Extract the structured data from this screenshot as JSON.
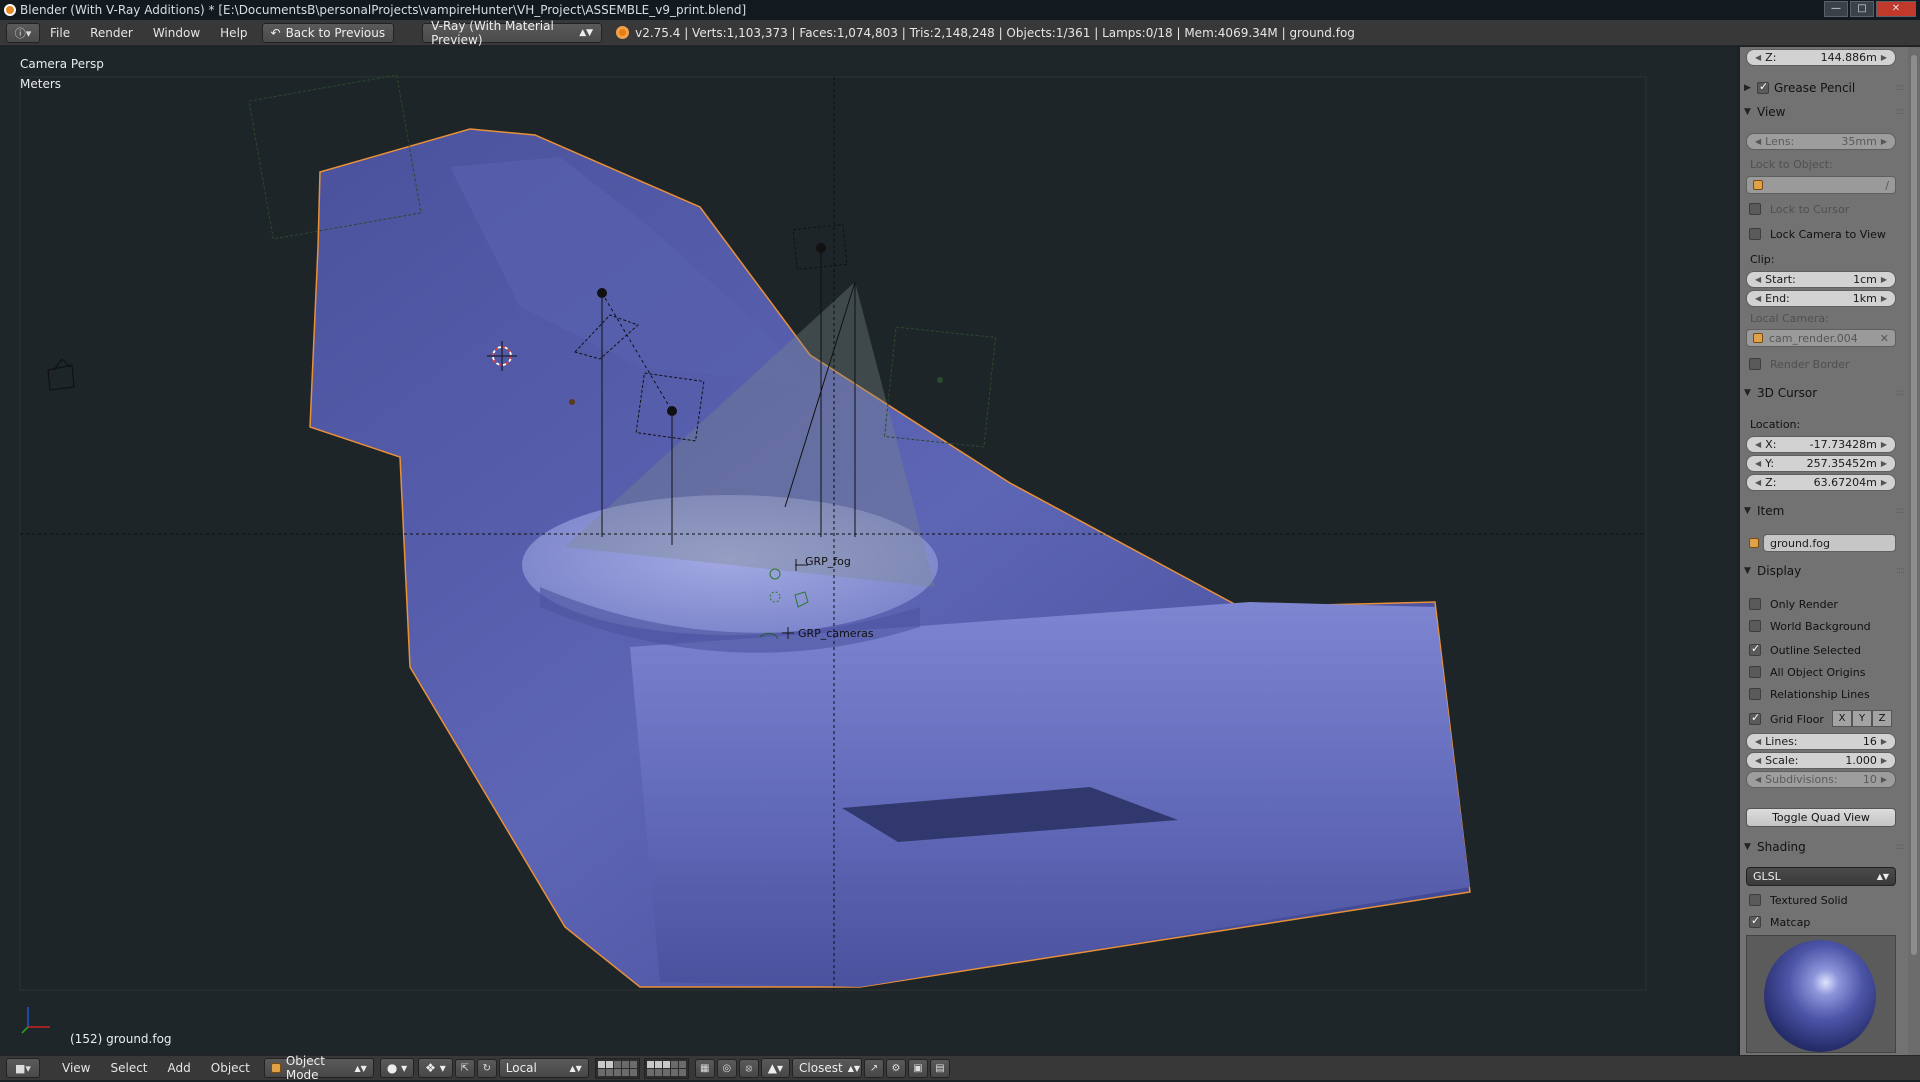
{
  "window": {
    "title": "Blender (With V-Ray Additions) * [E:\\DocumentsB\\personalProjects\\vampireHunter\\VH_Project\\ASSEMBLE_v9_print.blend]"
  },
  "info_header": {
    "menus": [
      "File",
      "Render",
      "Window",
      "Help"
    ],
    "back_button": "Back to Previous",
    "render_engine": "V-Ray (With Material Preview)",
    "stats": "v2.75.4 | Verts:1,103,373 | Faces:1,074,803 | Tris:2,148,248 | Objects:1/361 | Lamps:0/18 | Mem:4069.34M | ground.fog"
  },
  "viewport": {
    "view_name": "Camera Persp",
    "units": "Meters",
    "object_labels": [
      "GRP_fog",
      "GRP_cameras"
    ],
    "status": "(152) ground.fog"
  },
  "npanel": {
    "cursor_z_top": {
      "label": "Z:",
      "value": "144.886m"
    },
    "grease_pencil": {
      "label": "Grease Pencil",
      "checked": true
    },
    "view": {
      "title": "View",
      "lens": {
        "label": "Lens:",
        "value": "35mm"
      },
      "lock_to_object_label": "Lock to Object:",
      "lock_to_cursor": "Lock to Cursor",
      "lock_camera_to_view": "Lock Camera to View",
      "clip_label": "Clip:",
      "clip_start": {
        "label": "Start:",
        "value": "1cm"
      },
      "clip_end": {
        "label": "End:",
        "value": "1km"
      },
      "local_camera_label": "Local Camera:",
      "local_camera_value": "cam_render.004",
      "render_border": "Render Border"
    },
    "cursor3d": {
      "title": "3D Cursor",
      "location_label": "Location:",
      "x": {
        "label": "X:",
        "value": "-17.73428m"
      },
      "y": {
        "label": "Y:",
        "value": "257.35452m"
      },
      "z": {
        "label": "Z:",
        "value": "63.67204m"
      }
    },
    "item": {
      "title": "Item",
      "name": "ground.fog"
    },
    "display": {
      "title": "Display",
      "only_render": {
        "label": "Only Render",
        "checked": false
      },
      "world_background": {
        "label": "World Background",
        "checked": false
      },
      "outline_selected": {
        "label": "Outline Selected",
        "checked": true
      },
      "all_object_origins": {
        "label": "All Object Origins",
        "checked": false
      },
      "relationship_lines": {
        "label": "Relationship Lines",
        "checked": false
      },
      "grid_floor": {
        "label": "Grid Floor",
        "checked": true
      },
      "axes": [
        "X",
        "Y",
        "Z"
      ],
      "lines": {
        "label": "Lines:",
        "value": "16"
      },
      "scale": {
        "label": "Scale:",
        "value": "1.000"
      },
      "subdivisions": {
        "label": "Subdivisions:",
        "value": "10"
      },
      "toggle_quad_view": "Toggle Quad View"
    },
    "shading": {
      "title": "Shading",
      "mode": "GLSL",
      "textured_solid": {
        "label": "Textured Solid",
        "checked": false
      },
      "matcap": {
        "label": "Matcap",
        "checked": true
      }
    }
  },
  "bottom_header": {
    "menus": [
      "View",
      "Select",
      "Add",
      "Object"
    ],
    "mode": "Object Mode",
    "pivot": "Local",
    "snap": "Closest"
  },
  "colors": {
    "selection_outline": "#e8903a",
    "mesh_fill": "#5a62b0",
    "panel_bg": "#727272",
    "header_bg": "#383838"
  }
}
